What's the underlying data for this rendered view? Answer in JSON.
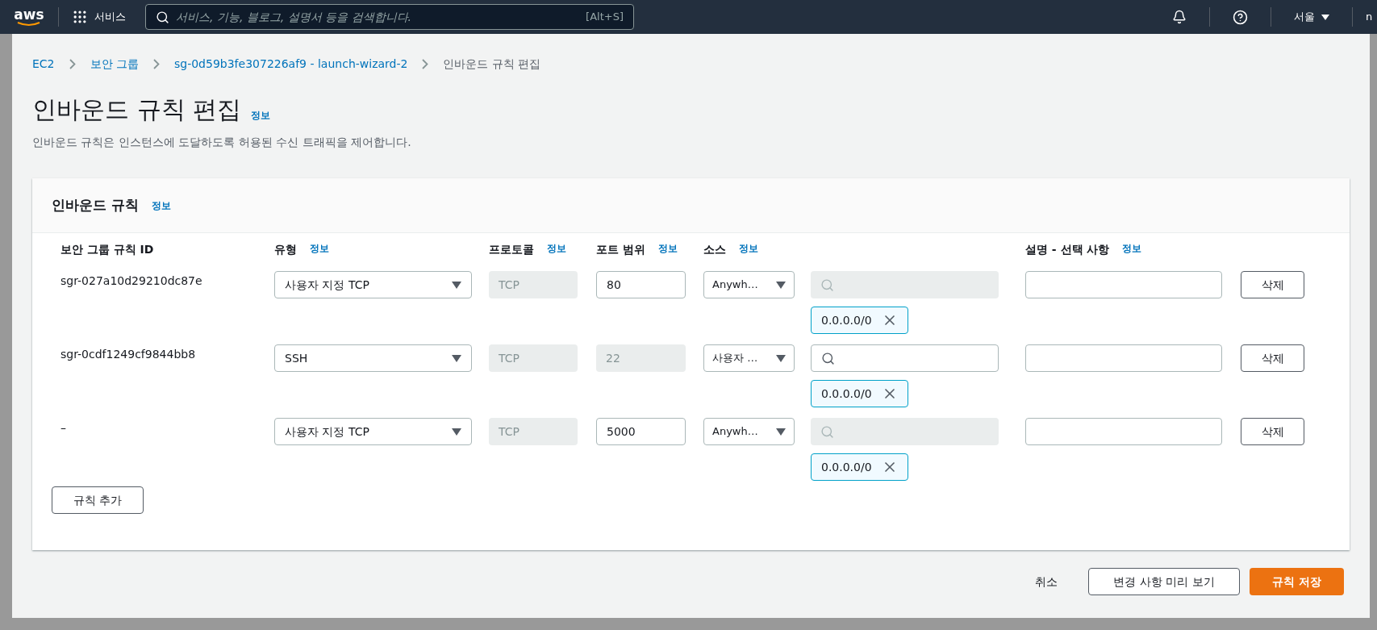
{
  "top_nav": {
    "logo": "aws",
    "services": "서비스",
    "search": {
      "placeholder": "서비스, 기능, 블로그, 설명서 등을 검색합니다.",
      "shortcut": "[Alt+S]"
    },
    "region": "서울",
    "account": "n"
  },
  "breadcrumbs": [
    {
      "label": "EC2",
      "link": true
    },
    {
      "label": "보안 그룹",
      "link": true
    },
    {
      "label": "sg-0d59b3fe307226af9 - launch-wizard-2",
      "link": true
    },
    {
      "label": "인바운드 규칙 편집",
      "link": false
    }
  ],
  "page": {
    "title": "인바운드 규칙 편집",
    "info": "정보",
    "description": "인바운드 규칙은 인스턴스에 도달하도록 허용된 수신 트래픽을 제어합니다."
  },
  "panel": {
    "title": "인바운드 규칙",
    "info": "정보",
    "columns": [
      {
        "label": "보안 그룹 규칙 ID"
      },
      {
        "label": "유형",
        "info": "정보"
      },
      {
        "label": "프로토콜",
        "info": "정보"
      },
      {
        "label": "포트 범위",
        "info": "정보"
      },
      {
        "label": "소스",
        "info": "정보"
      },
      {
        "label": "설명 - 선택 사항",
        "info": "정보"
      }
    ],
    "rows": [
      {
        "id": "sgr-027a10d29210dc87e",
        "type": "사용자 지정 TCP",
        "protocol": "TCP",
        "port": "80",
        "port_disabled": false,
        "source": "Anywh…",
        "source_search_disabled": true,
        "cidr": "0.0.0.0/0",
        "delete": "삭제"
      },
      {
        "id": "sgr-0cdf1249cf9844bb8",
        "type": "SSH",
        "protocol": "TCP",
        "port": "22",
        "port_disabled": true,
        "source": "사용자 …",
        "source_search_disabled": false,
        "cidr": "0.0.0.0/0",
        "delete": "삭제"
      },
      {
        "id": "–",
        "type": "사용자 지정 TCP",
        "protocol": "TCP",
        "port": "5000",
        "port_disabled": false,
        "source": "Anywh…",
        "source_search_disabled": true,
        "cidr": "0.0.0.0/0",
        "delete": "삭제"
      }
    ],
    "add_rule": "규칙 추가"
  },
  "footer": {
    "cancel": "취소",
    "preview": "변경 사항 미리 보기",
    "save": "규칙 저장"
  }
}
